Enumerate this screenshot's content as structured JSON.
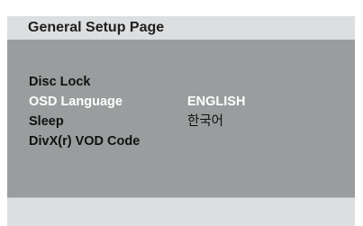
{
  "header": {
    "title": "General Setup Page"
  },
  "menu": {
    "items": [
      {
        "label": "Disc Lock",
        "value": ""
      },
      {
        "label": "OSD Language",
        "value": "ENGLISH"
      },
      {
        "label": "Sleep",
        "value": "한국어"
      },
      {
        "label": "DivX(r) VOD Code",
        "value": ""
      }
    ]
  },
  "colors": {
    "background": "#9a9d9e",
    "header_bar": "#dcdedf",
    "text": "#111111",
    "selected_text": "#ffffff"
  }
}
